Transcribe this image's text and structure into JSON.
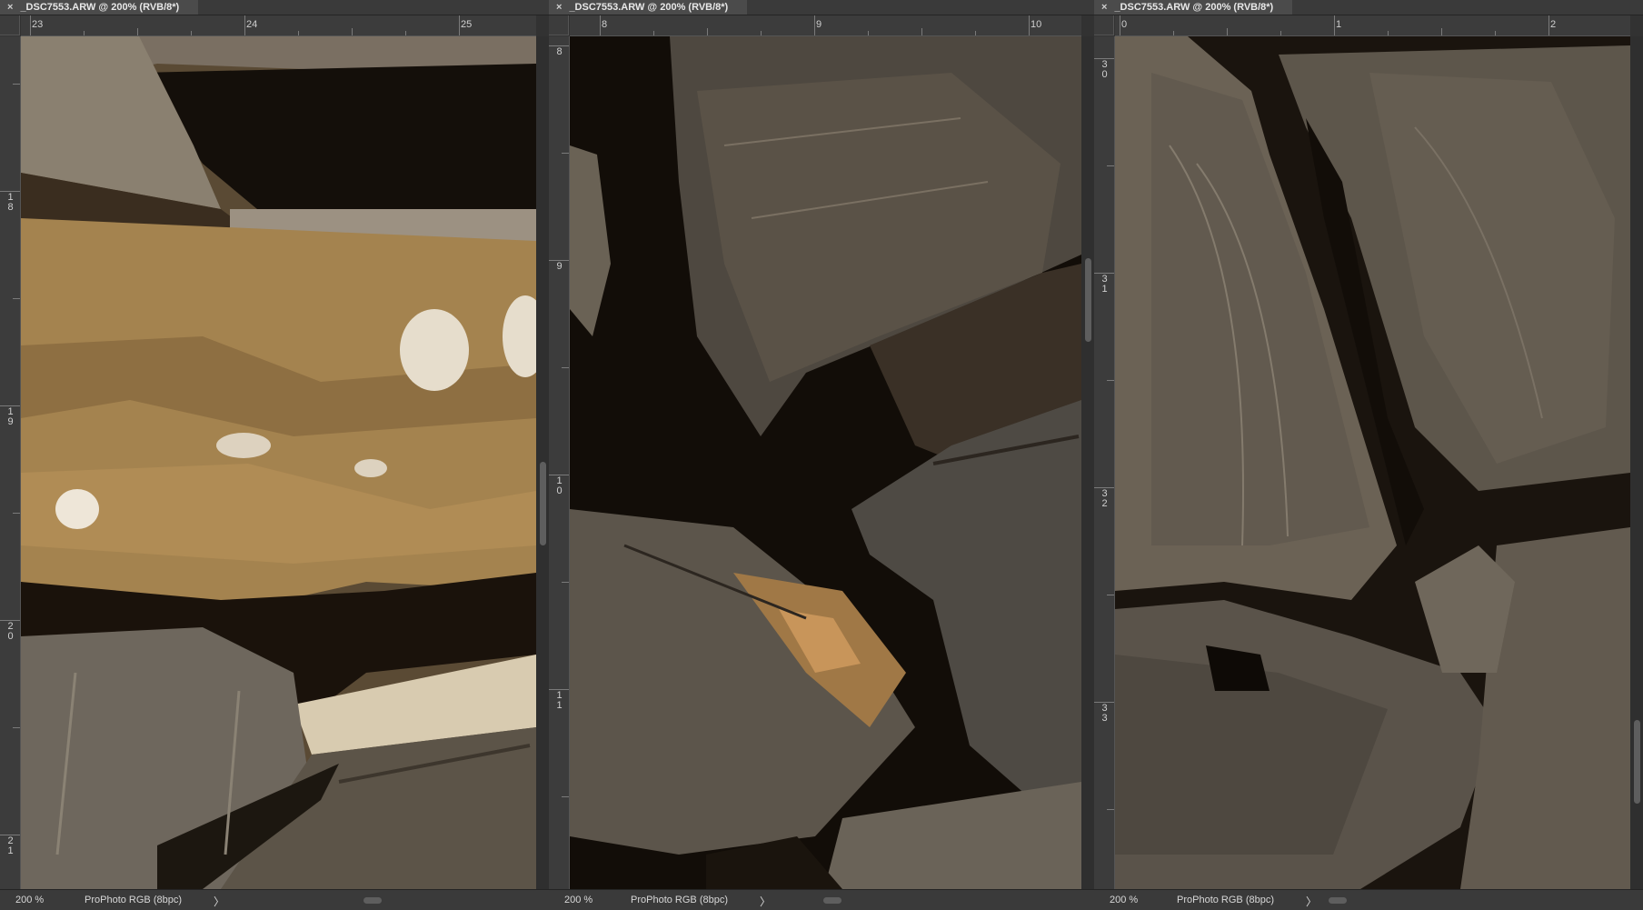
{
  "tab_title": "_DSC7553.ARW @ 200% (RVB/8*)",
  "close_glyph": "×",
  "arrow_glyph": "〉",
  "panels": [
    {
      "zoom": "200 %",
      "profile": "ProPhoto RGB (8bpc)",
      "h_ruler": [
        "23",
        "24",
        "25"
      ],
      "v_ruler": [
        "18",
        "19",
        "20",
        "21"
      ]
    },
    {
      "zoom": "200 %",
      "profile": "ProPhoto RGB (8bpc)",
      "h_ruler": [
        "8",
        "9",
        "10"
      ],
      "v_ruler": [
        "8",
        "9",
        "10",
        "11"
      ]
    },
    {
      "zoom": "200 %",
      "profile": "ProPhoto RGB (8bpc)",
      "h_ruler": [
        "0",
        "1",
        "2"
      ],
      "v_ruler": [
        "30",
        "31",
        "32",
        "33"
      ]
    }
  ],
  "colors": {
    "wood_light": "#a4834f",
    "wood_gray": "#6b6255",
    "shadow": "#140f0a",
    "cut_face": "#4e4840"
  },
  "icons": {
    "close": "close-icon",
    "scroll_arrow": "chevron-right-icon"
  }
}
